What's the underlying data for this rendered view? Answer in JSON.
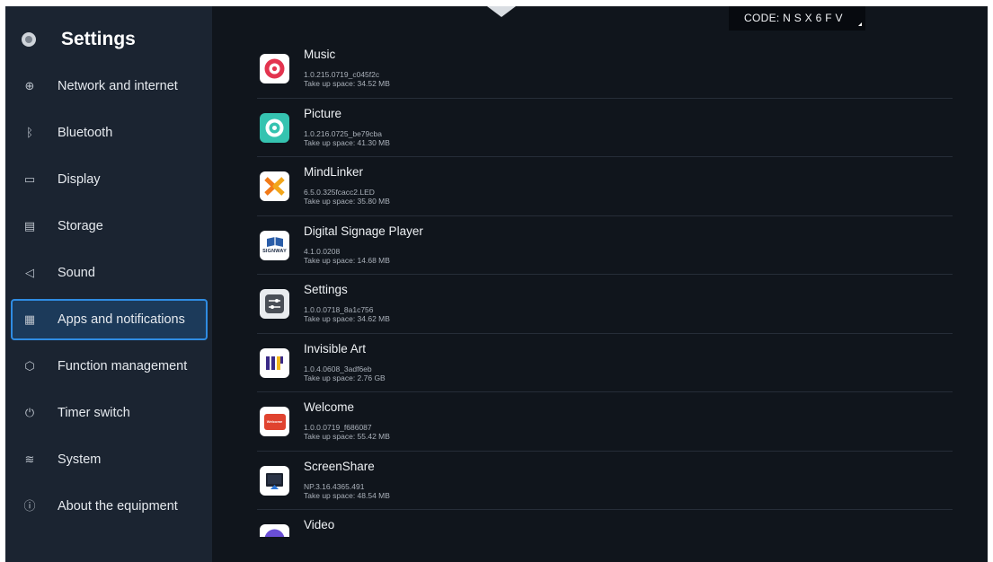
{
  "sidebar": {
    "title": "Settings",
    "title_icon": "settings-gear-icon",
    "items": [
      {
        "label": "Network and internet",
        "icon": "globe-icon",
        "glyph": "⊕",
        "active": false
      },
      {
        "label": "Bluetooth",
        "icon": "bluetooth-icon",
        "glyph": "ᛒ",
        "active": false
      },
      {
        "label": "Display",
        "icon": "monitor-icon",
        "glyph": "▭",
        "active": false
      },
      {
        "label": "Storage",
        "icon": "storage-icon",
        "glyph": "▤",
        "active": false
      },
      {
        "label": "Sound",
        "icon": "speaker-icon",
        "glyph": "◁",
        "active": false
      },
      {
        "label": "Apps and notifications",
        "icon": "apps-grid-icon",
        "glyph": "▦",
        "active": true
      },
      {
        "label": "Function management",
        "icon": "cube-icon",
        "glyph": "⬡",
        "active": false
      },
      {
        "label": "Timer switch",
        "icon": "power-icon",
        "glyph": "⏻",
        "active": false
      },
      {
        "label": "System",
        "icon": "sliders-icon",
        "glyph": "≋",
        "active": false
      },
      {
        "label": "About the equipment",
        "icon": "info-icon",
        "glyph": "ⓘ",
        "active": false
      }
    ]
  },
  "header": {
    "code_text": "CODE: N S X 6 F V"
  },
  "apps": [
    {
      "name": "Music",
      "version": "1.0.215.0719_c045f2c",
      "size": "Take up space: 34.52 MB",
      "icon": "music-app-icon"
    },
    {
      "name": "Picture",
      "version": "1.0.216.0725_be79cba",
      "size": "Take up space: 41.30 MB",
      "icon": "picture-app-icon"
    },
    {
      "name": "MindLinker",
      "version": "6.5.0.325fcacc2.LED",
      "size": "Take up space: 35.80 MB",
      "icon": "mindlinker-app-icon"
    },
    {
      "name": "Digital Signage Player",
      "version": "4.1.0.0208",
      "size": "Take up space: 14.68 MB",
      "icon": "signway-app-icon",
      "icon_text": "SIGNWAY"
    },
    {
      "name": "Settings",
      "version": "1.0.0.0718_8a1c756",
      "size": "Take up space: 34.62 MB",
      "icon": "settings-app-icon"
    },
    {
      "name": "Invisible Art",
      "version": "1.0.4.0608_3adf6eb",
      "size": "Take up space: 2.76 GB",
      "icon": "invisible-art-app-icon"
    },
    {
      "name": "Welcome",
      "version": "1.0.0.0719_f686087",
      "size": "Take up space: 55.42 MB",
      "icon": "welcome-app-icon",
      "icon_text": "Welcome"
    },
    {
      "name": "ScreenShare",
      "version": "NP.3.16.4365.491",
      "size": "Take up space: 48.54 MB",
      "icon": "screenshare-app-icon"
    },
    {
      "name": "Video",
      "version": "",
      "size": "",
      "icon": "video-app-icon"
    }
  ],
  "colors": {
    "background": "#10151c",
    "sidebar": "#1b2431",
    "active_border": "#2f8ce3",
    "active_fill": "#1c3a5a"
  }
}
